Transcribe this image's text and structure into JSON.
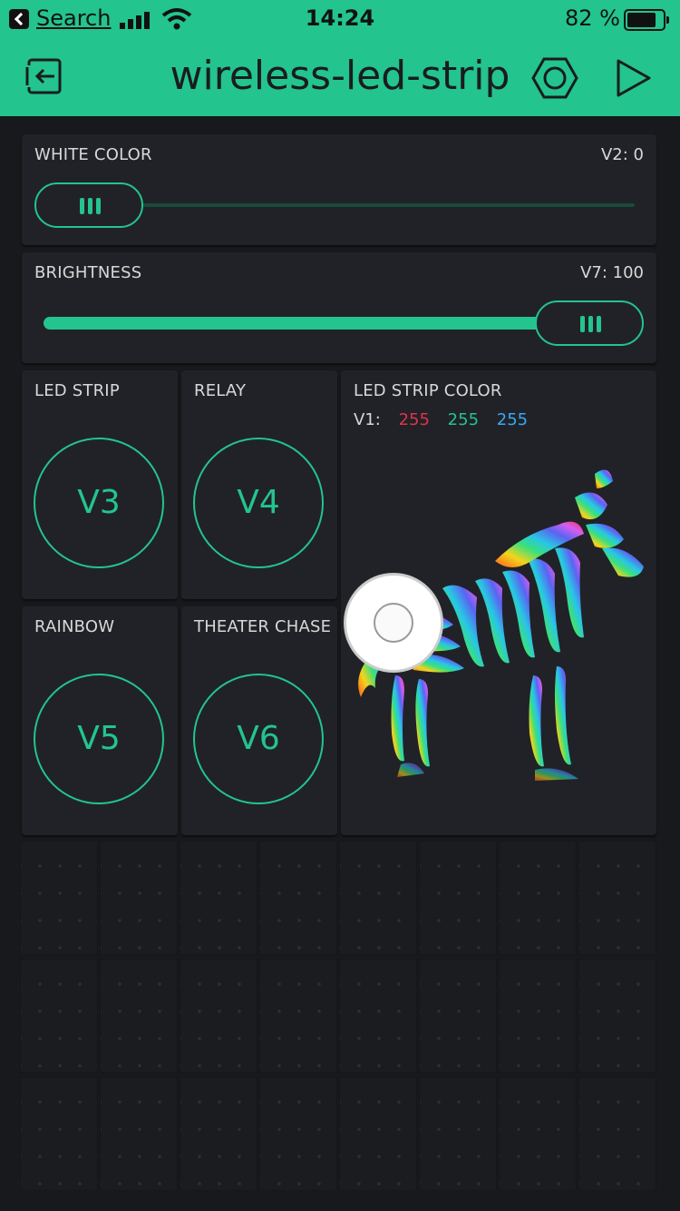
{
  "status_bar": {
    "back_label": "Search",
    "time": "14:24",
    "battery_percent": "82 %",
    "battery_level": 0.82
  },
  "header": {
    "title": "wireless-led-strip"
  },
  "widgets": {
    "white_color": {
      "label": "WHITE COLOR",
      "value": "V2: 0",
      "level": 0.0
    },
    "brightness": {
      "label": "BRIGHTNESS",
      "value": "V7: 100",
      "level": 1.0
    },
    "led_strip": {
      "label": "LED STRIP",
      "pin": "V3"
    },
    "relay": {
      "label": "RELAY",
      "pin": "V4"
    },
    "rainbow": {
      "label": "RAINBOW",
      "pin": "V5"
    },
    "theater_chase": {
      "label": "THEATER CHASE",
      "pin": "V6"
    },
    "led_strip_color": {
      "label": "LED STRIP COLOR",
      "pin_prefix": "V1:",
      "r": "255",
      "g": "255",
      "b": "255",
      "r_color": "#e0334b",
      "g_color": "#23c48e",
      "b_color": "#3aa8f0"
    }
  },
  "colors": {
    "accent": "#23c48e",
    "background": "#18191c",
    "panel": "#212227"
  }
}
